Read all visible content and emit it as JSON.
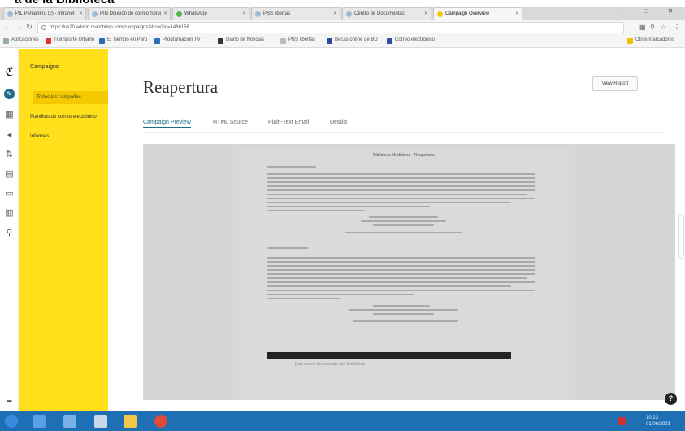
{
  "doc_heading": "a de la Biblioteca",
  "browser": {
    "tabs": [
      {
        "label": "PIL Pemahkru (2) - Intranet",
        "active": false
      },
      {
        "label": "PIN Dilución de correo Servi",
        "active": false
      },
      {
        "label": "WhatsApp",
        "active": false
      },
      {
        "label": "PBS libertas",
        "active": false
      },
      {
        "label": "Centro de Documentac",
        "active": false
      },
      {
        "label": "Campaign Overview",
        "active": true
      }
    ],
    "url": "https://us20.admin.mailchimp.com/campaigns/show?id=1466156",
    "bookmarks": [
      "Aplicaciones",
      "Transporte Urbano",
      "El Tiempo en Perú",
      "Programación TV",
      "Diario de Noticias",
      "PBS libertas",
      "Becas online de BD",
      "Correo electrónico",
      "Otros marcadores"
    ]
  },
  "campaigns_nav": {
    "title": "Campaigns",
    "items": [
      "Todas las campañas",
      "Plantillas de correo electrónico",
      "Informes"
    ]
  },
  "main": {
    "title": "Reapertura",
    "view_report_label": "View Report",
    "tabs": [
      {
        "label": "Campaign Preview",
        "active": true
      },
      {
        "label": "HTML Source",
        "active": false
      },
      {
        "label": "Plain-Text Email",
        "active": false
      },
      {
        "label": "Details",
        "active": false
      }
    ]
  },
  "email_preview": {
    "heading": "Biblioteca Mediateca · Reapertura"
  },
  "footer_note": "Este correo fue enviado con Mailchimp",
  "help_label": "?",
  "taskbar": {
    "time": "10:23",
    "date": "01/06/2021"
  }
}
